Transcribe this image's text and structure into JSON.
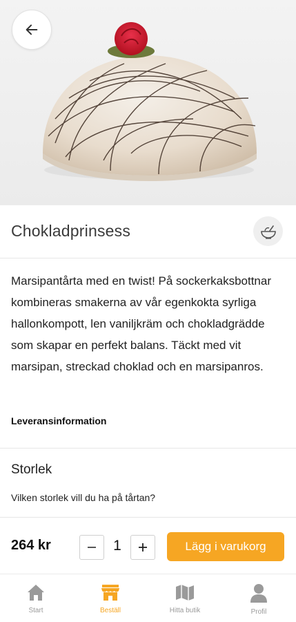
{
  "header": {
    "back_icon": "arrow-left-icon"
  },
  "product": {
    "title": "Chokladprinsess",
    "image_icon": "cake-image",
    "side_icon": "bowl-icon",
    "description": "Marsipantårta med en twist! På sockerkaksbottnar kombineras smakerna av vår egenkokta syrliga hallonkompott, len vaniljkräm och chokladgrädde som skapar en perfekt balans. Täckt med vit marsipan, streckad choklad och en marsipanros.",
    "delivery_info_label": "Leveransinformation"
  },
  "size": {
    "title": "Storlek",
    "question": "Vilken storlek vill du ha på tårtan?"
  },
  "purchase": {
    "price": "264 kr",
    "quantity": "1",
    "minus_label": "−",
    "plus_label": "+",
    "add_to_cart_label": "Lägg i varukorg"
  },
  "nav": {
    "items": [
      {
        "label": "Start",
        "icon": "home-icon",
        "active": false
      },
      {
        "label": "Beställ",
        "icon": "shop-icon",
        "active": true
      },
      {
        "label": "Hitta butik",
        "icon": "map-icon",
        "active": false
      },
      {
        "label": "Profil",
        "icon": "person-icon",
        "active": false
      }
    ]
  },
  "colors": {
    "accent": "#f6a623",
    "nav_inactive": "#9a9a9a",
    "divider": "#e6e6e6"
  }
}
